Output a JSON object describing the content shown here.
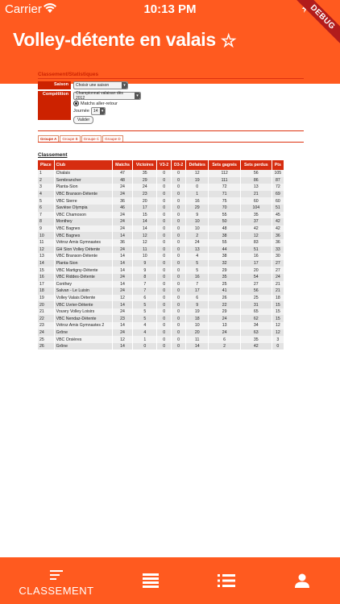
{
  "status_bar": {
    "carrier": "Carrier",
    "time": "10:13 PM"
  },
  "debug_ribbon": "DEBUG",
  "app_title": "Volley-détente en valais",
  "section_title": "Classement/Statistiques",
  "form": {
    "saison_label": "Saison",
    "saison_value": "Choisir une saison",
    "competition_label": "Compétition",
    "competition_value": "Championnat valaisan dès 2012",
    "radio_label": "Matchs aller-retour",
    "journee_label": "Journée",
    "journee_value": "14",
    "submit_label": "Valider"
  },
  "groups": [
    "Groupe A",
    "Groupe B",
    "Groupe C",
    "Groupe D"
  ],
  "classement_title": "Classement",
  "table": {
    "headers": [
      "Place",
      "Club",
      "Matchs",
      "Victoires",
      "V3-2",
      "D3-2",
      "Défaites",
      "Sets gagnés",
      "Sets perdus",
      "Pts"
    ],
    "rows": [
      [
        "1",
        "Chalais",
        "47",
        "35",
        "0",
        "0",
        "12",
        "112",
        "56",
        "105"
      ],
      [
        "2",
        "Sembrancher",
        "48",
        "29",
        "0",
        "0",
        "19",
        "111",
        "86",
        "87"
      ],
      [
        "3",
        "Planta-Sion",
        "24",
        "24",
        "0",
        "0",
        "0",
        "72",
        "13",
        "72"
      ],
      [
        "4",
        "VBC Branson-Détente",
        "24",
        "23",
        "0",
        "0",
        "1",
        "71",
        "21",
        "69"
      ],
      [
        "5",
        "VBC Sierre",
        "36",
        "20",
        "0",
        "0",
        "16",
        "75",
        "60",
        "60"
      ],
      [
        "6",
        "Savièse Olympia",
        "46",
        "17",
        "0",
        "0",
        "29",
        "70",
        "104",
        "51"
      ],
      [
        "7",
        "VBC Chamoson",
        "24",
        "15",
        "0",
        "0",
        "9",
        "55",
        "35",
        "45"
      ],
      [
        "8",
        "Monthey",
        "24",
        "14",
        "0",
        "0",
        "10",
        "50",
        "37",
        "42"
      ],
      [
        "9",
        "VBC Bagnes",
        "24",
        "14",
        "0",
        "0",
        "10",
        "48",
        "42",
        "42"
      ],
      [
        "10",
        "VBC Bagnes",
        "14",
        "12",
        "0",
        "0",
        "2",
        "38",
        "12",
        "36"
      ],
      [
        "11",
        "Vétroz Amis Gymnastes",
        "36",
        "12",
        "0",
        "0",
        "24",
        "55",
        "83",
        "36"
      ],
      [
        "12",
        "GH Sion Volley Détente",
        "24",
        "11",
        "0",
        "0",
        "13",
        "44",
        "51",
        "33"
      ],
      [
        "13",
        "VBC Branson-Détente",
        "14",
        "10",
        "0",
        "0",
        "4",
        "38",
        "16",
        "30"
      ],
      [
        "14",
        "Planta-Sion",
        "14",
        "9",
        "0",
        "0",
        "5",
        "32",
        "17",
        "27"
      ],
      [
        "15",
        "VBC Martigny-Détente",
        "14",
        "9",
        "0",
        "0",
        "5",
        "29",
        "20",
        "27"
      ],
      [
        "16",
        "VBC Riddes-Détente",
        "24",
        "8",
        "0",
        "0",
        "16",
        "35",
        "54",
        "24"
      ],
      [
        "17",
        "Conthey",
        "14",
        "7",
        "0",
        "0",
        "7",
        "25",
        "27",
        "21"
      ],
      [
        "18",
        "Salvan - Le Luisin",
        "24",
        "7",
        "0",
        "0",
        "17",
        "41",
        "56",
        "21"
      ],
      [
        "19",
        "Volley Valais Détente",
        "12",
        "6",
        "0",
        "0",
        "6",
        "26",
        "25",
        "18"
      ],
      [
        "20",
        "VBC Uvrier-Détente",
        "14",
        "5",
        "0",
        "0",
        "9",
        "22",
        "31",
        "15"
      ],
      [
        "21",
        "Vouvry Volley Loisirs",
        "24",
        "5",
        "0",
        "0",
        "19",
        "29",
        "65",
        "15"
      ],
      [
        "22",
        "VBC Nendaz-Détente",
        "23",
        "5",
        "0",
        "0",
        "18",
        "24",
        "62",
        "15"
      ],
      [
        "23",
        "Vétroz Amis Gymnastes 2",
        "14",
        "4",
        "0",
        "0",
        "10",
        "13",
        "34",
        "12"
      ],
      [
        "24",
        "Grône",
        "24",
        "4",
        "0",
        "0",
        "20",
        "24",
        "63",
        "12"
      ],
      [
        "25",
        "VBC Orsières",
        "12",
        "1",
        "0",
        "0",
        "11",
        "6",
        "35",
        "3"
      ],
      [
        "26",
        "Grône",
        "14",
        "0",
        "0",
        "0",
        "14",
        "2",
        "42",
        "0"
      ]
    ]
  },
  "bottom_nav": {
    "classement_label": "CLASSEMENT",
    "icons": [
      "classement-icon",
      "list-icon",
      "bullet-list-icon",
      "person-icon"
    ]
  }
}
